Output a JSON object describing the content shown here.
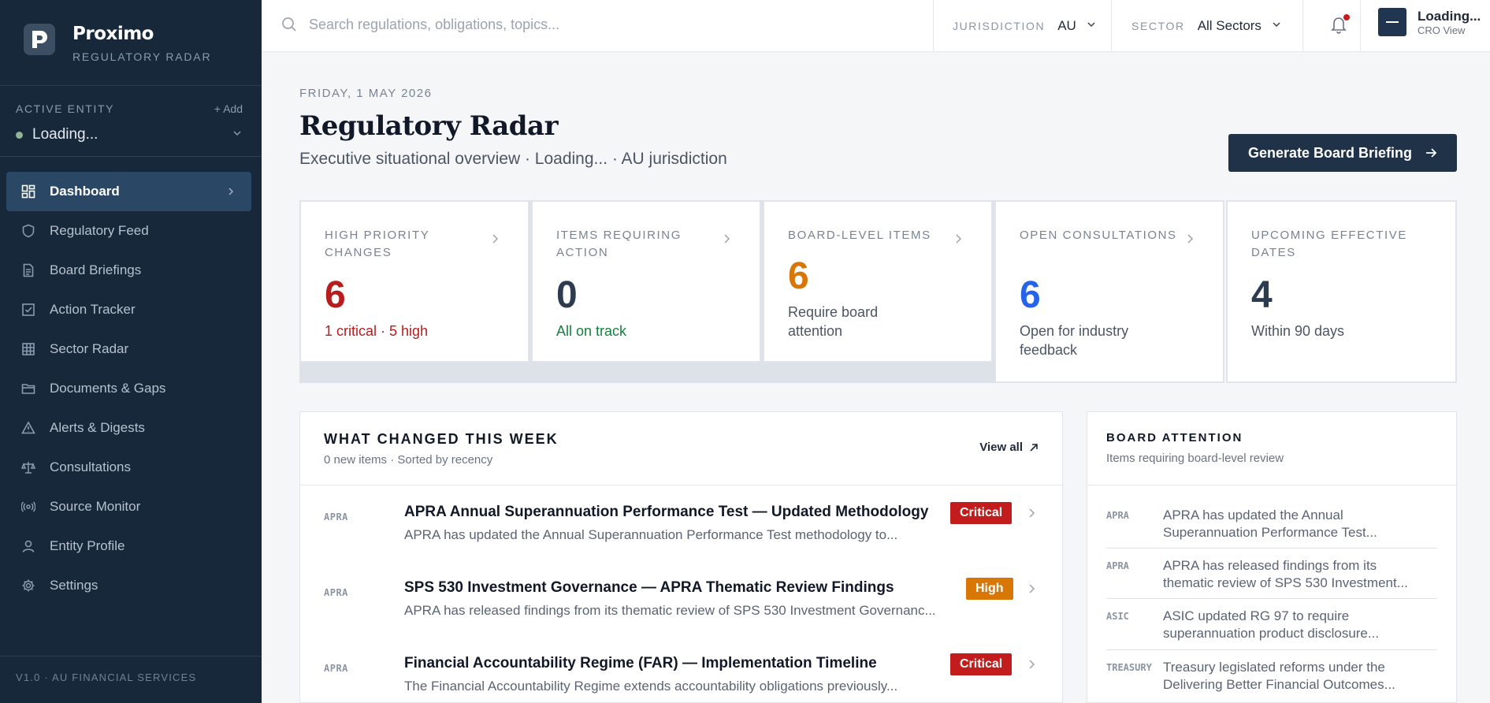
{
  "brand": {
    "name": "Proximo",
    "subtitle": "REGULATORY RADAR"
  },
  "entity": {
    "label": "ACTIVE ENTITY",
    "add_label": "+ Add",
    "value": "Loading..."
  },
  "nav": [
    {
      "label": "Dashboard",
      "icon": "dashboard-icon"
    },
    {
      "label": "Regulatory Feed",
      "icon": "shield-icon"
    },
    {
      "label": "Board Briefings",
      "icon": "document-icon"
    },
    {
      "label": "Action Tracker",
      "icon": "checkbox-icon"
    },
    {
      "label": "Sector Radar",
      "icon": "grid-icon"
    },
    {
      "label": "Documents & Gaps",
      "icon": "folder-icon"
    },
    {
      "label": "Alerts & Digests",
      "icon": "warning-icon"
    },
    {
      "label": "Consultations",
      "icon": "scales-icon"
    },
    {
      "label": "Source Monitor",
      "icon": "broadcast-icon"
    },
    {
      "label": "Entity Profile",
      "icon": "user-icon"
    },
    {
      "label": "Settings",
      "icon": "gear-icon"
    }
  ],
  "version": "V1.0 · AU FINANCIAL SERVICES",
  "topbar": {
    "search_placeholder": "Search regulations, obligations, topics...",
    "jurisdiction_label": "JURISDICTION",
    "jurisdiction_value": "AU",
    "sector_label": "SECTOR",
    "sector_value": "All Sectors",
    "user_name": "Loading...",
    "user_role": "CRO View"
  },
  "header": {
    "date": "FRIDAY, 1 MAY 2026",
    "title": "Regulatory Radar",
    "subtitle": "Executive situational overview · Loading... · AU jurisdiction",
    "briefing_button": "Generate Board Briefing"
  },
  "kpis": [
    {
      "label": "HIGH PRIORITY CHANGES",
      "value": "6",
      "note": "1 critical · 5 high",
      "color": "#b91c1c",
      "note_color": "#b91c1c"
    },
    {
      "label": "ITEMS REQUIRING ACTION",
      "value": "0",
      "note": "All on track",
      "color": "#2d3b4e",
      "note_color": "#15803d"
    },
    {
      "label": "BOARD-LEVEL ITEMS",
      "value": "6",
      "note": "Require board attention",
      "color": "#d97706",
      "note_color": "#4b5563"
    },
    {
      "label": "OPEN CONSULTATIONS",
      "value": "6",
      "note": "Open for industry feedback",
      "color": "#2563eb",
      "note_color": "#4b5563"
    },
    {
      "label": "UPCOMING EFFECTIVE DATES",
      "value": "4",
      "note": "Within 90 days",
      "color": "#2d3b4e",
      "note_color": "#4b5563"
    }
  ],
  "changes": {
    "title": "WHAT CHANGED THIS WEEK",
    "subtitle": "0 new items · Sorted by recency",
    "view_all": "View all",
    "items": [
      {
        "source": "APRA",
        "title": "APRA Annual Superannuation Performance Test — Updated Methodology",
        "desc": "APRA has updated the Annual Superannuation Performance Test methodology to...",
        "severity": "Critical",
        "severity_color": "#c21c1c"
      },
      {
        "source": "APRA",
        "title": "SPS 530 Investment Governance — APRA Thematic Review Findings",
        "desc": "APRA has released findings from its thematic review of SPS 530 Investment Governanc...",
        "severity": "High",
        "severity_color": "#d97706"
      },
      {
        "source": "APRA",
        "title": "Financial Accountability Regime (FAR) — Implementation Timeline",
        "desc": "The Financial Accountability Regime extends accountability obligations previously...",
        "severity": "Critical",
        "severity_color": "#c21c1c"
      }
    ]
  },
  "board": {
    "title": "BOARD ATTENTION",
    "subtitle": "Items requiring board-level review",
    "items": [
      {
        "source": "APRA",
        "text": "APRA has updated the Annual Superannuation Performance Test..."
      },
      {
        "source": "APRA",
        "text": "APRA has released findings from its thematic review of SPS 530 Investment..."
      },
      {
        "source": "ASIC",
        "text": "ASIC updated RG 97 to require superannuation product disclosure..."
      },
      {
        "source": "TREASURY",
        "text": "Treasury legislated reforms under the Delivering Better Financial Outcomes..."
      }
    ]
  }
}
